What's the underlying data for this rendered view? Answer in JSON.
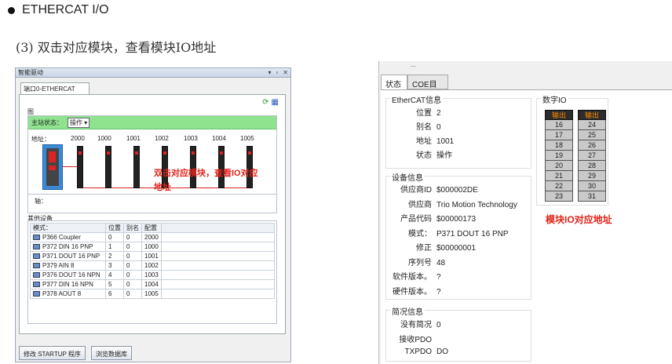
{
  "heading": "ETHERCAT I/O",
  "step": "(3) 双击对应模块，查看模块IO地址",
  "left_window": {
    "title": "智能驱动",
    "controls": [
      "▾",
      "▫",
      "✕"
    ],
    "tab": "端口0-ETHERCAT",
    "diagram_label": "图",
    "master_state_label": "主站状态：",
    "master_state_value": "操作",
    "address_label": "地址：",
    "addresses": [
      "2000",
      "1000",
      "1001",
      "1002",
      "1003",
      "1004",
      "1005"
    ],
    "axis_label": "轴：",
    "other_devices_label": "其他设备",
    "table": {
      "headers": [
        "模式：",
        "位置",
        "别名",
        "配置"
      ],
      "rows": [
        [
          "P366 Coupler",
          "0",
          "0",
          "2000"
        ],
        [
          "P372 DIN 16 PNP",
          "1",
          "0",
          "1000"
        ],
        [
          "P371 DOUT 16 PNP",
          "2",
          "0",
          "1001"
        ],
        [
          "P379 AIN 8",
          "3",
          "0",
          "1002"
        ],
        [
          "P376 DOUT 16 NPN",
          "4",
          "0",
          "1003"
        ],
        [
          "P377 DIN 16 NPN",
          "5",
          "0",
          "1004"
        ],
        [
          "P378 AOUT 8",
          "6",
          "0",
          "1005"
        ]
      ]
    },
    "annotation": "双击对应模块，查看IO对应地址",
    "buttons": [
      "修改 STARTUP 程序",
      "浏览数据库"
    ]
  },
  "right_window": {
    "title_fragment": "...",
    "tabs": [
      "状态",
      "COE目标"
    ],
    "ethercat_info": {
      "legend": "EtherCAT信息",
      "items": [
        {
          "k": "位置",
          "v": "2"
        },
        {
          "k": "别名",
          "v": "0"
        },
        {
          "k": "地址",
          "v": "1001"
        },
        {
          "k": "状态",
          "v": "操作"
        }
      ]
    },
    "device_info": {
      "legend": "设备信息",
      "items": [
        {
          "k": "供应商ID",
          "v": "$000002DE"
        },
        {
          "k": "供应商",
          "v": "Trio Motion Technology"
        },
        {
          "k": "产品代码",
          "v": "$00000173"
        },
        {
          "k": "模式：",
          "v": "P371 DOUT 16 PNP"
        },
        {
          "k": "修正",
          "v": "$00000001"
        },
        {
          "k": "序列号",
          "v": "48"
        },
        {
          "k": "软件版本。",
          "v": "?"
        },
        {
          "k": "硬件版本。",
          "v": "?"
        }
      ]
    },
    "overview": {
      "legend": "简况信息",
      "items": [
        {
          "k": "没有简况",
          "v": "0"
        },
        {
          "k": "接收PDO",
          "v": ""
        },
        {
          "k": "TXPDO",
          "v": "DO"
        }
      ]
    },
    "digital_io": {
      "legend": "数字IO",
      "col_header": "输出",
      "col1": [
        "16",
        "17",
        "18",
        "19",
        "20",
        "21",
        "22",
        "23"
      ],
      "col2": [
        "24",
        "25",
        "26",
        "27",
        "28",
        "29",
        "30",
        "31"
      ]
    },
    "annotation": "模块IO对应地址"
  }
}
